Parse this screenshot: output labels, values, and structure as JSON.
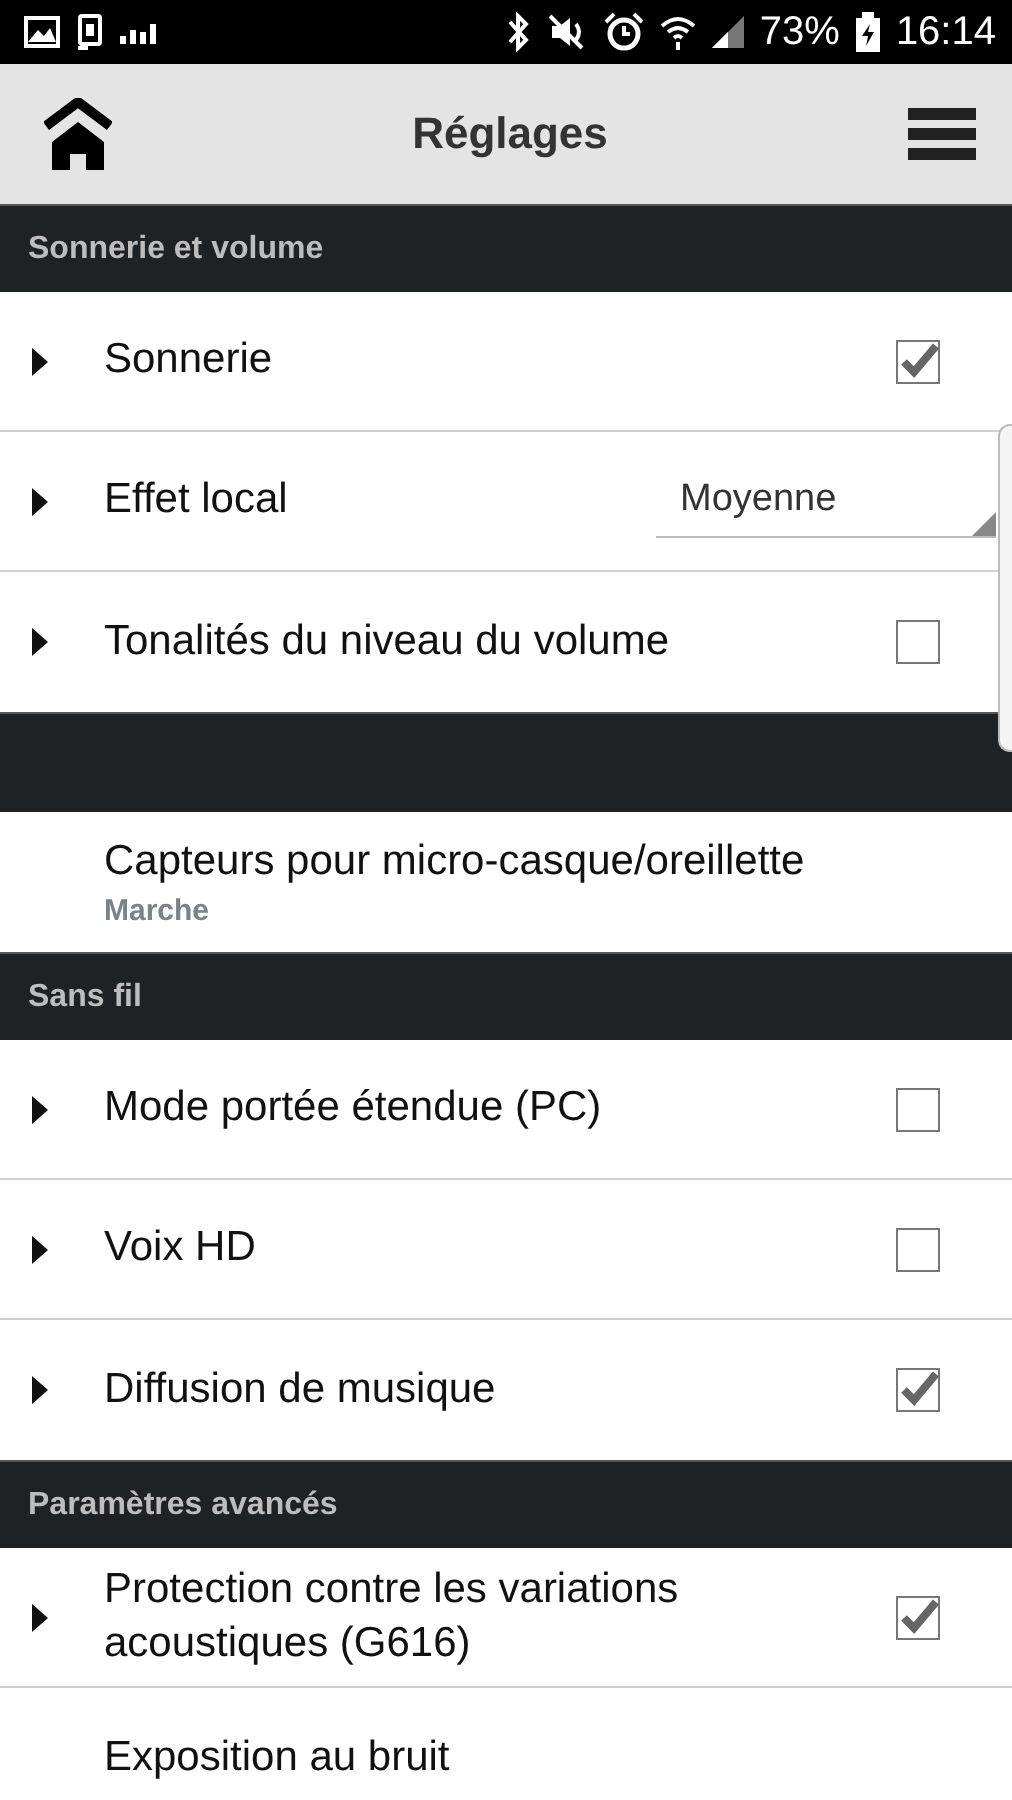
{
  "status_bar": {
    "battery": "73%",
    "time": "16:14"
  },
  "app_bar": {
    "title": "Réglages"
  },
  "sections": [
    {
      "header": "Sonnerie et volume",
      "items": [
        {
          "kind": "checkbox",
          "label": "Sonnerie",
          "expandable": true,
          "checked": true
        },
        {
          "kind": "dropdown",
          "label": "Effet local",
          "expandable": true,
          "value": "Moyenne"
        },
        {
          "kind": "checkbox",
          "label": "Tonalités du niveau du volume",
          "expandable": true,
          "checked": false
        }
      ]
    },
    {
      "items": [
        {
          "kind": "value",
          "label": "Capteurs pour micro-casque/oreillette",
          "expandable": false,
          "value": "Marche"
        }
      ]
    },
    {
      "header": "Sans fil",
      "items": [
        {
          "kind": "checkbox",
          "label": "Mode portée étendue (PC)",
          "expandable": true,
          "checked": false
        },
        {
          "kind": "checkbox",
          "label": "Voix HD",
          "expandable": true,
          "checked": false
        },
        {
          "kind": "checkbox",
          "label": "Diffusion de musique",
          "expandable": true,
          "checked": true
        }
      ]
    },
    {
      "header": "Paramètres avancés",
      "items": [
        {
          "kind": "checkbox",
          "label": "Protection contre les variations acoustiques (G616)",
          "expandable": true,
          "checked": true
        },
        {
          "kind": "plain",
          "label": "Exposition au bruit",
          "expandable": false
        }
      ]
    }
  ]
}
